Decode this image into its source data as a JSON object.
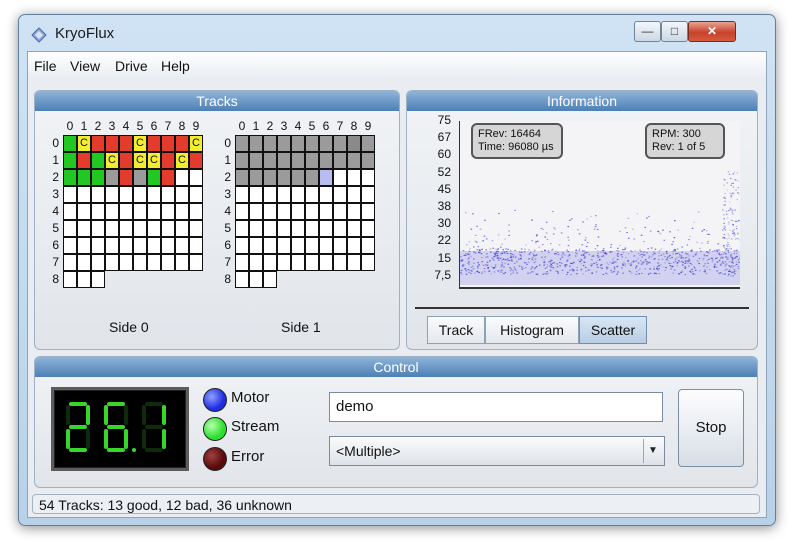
{
  "window": {
    "title": "KryoFlux"
  },
  "menu": {
    "items": [
      "File",
      "View",
      "Drive",
      "Help"
    ]
  },
  "tracks": {
    "header": "Tracks",
    "col_numbers": [
      "0",
      "1",
      "2",
      "3",
      "4",
      "5",
      "6",
      "7",
      "8",
      "9"
    ],
    "row_numbers": [
      "0",
      "1",
      "2",
      "3",
      "4",
      "5",
      "6",
      "7",
      "8"
    ],
    "side0_label": "Side 0",
    "side1_label": "Side 1",
    "cell_letter": "C",
    "side0_states": [
      [
        "good",
        "warn",
        "bad",
        "bad",
        "bad",
        "warn",
        "bad",
        "bad",
        "bad",
        "warn"
      ],
      [
        "good",
        "bad",
        "good",
        "warn",
        "bad",
        "warn",
        "warn",
        "bad",
        "warn",
        "bad"
      ],
      [
        "good",
        "good",
        "good",
        "grey",
        "bad",
        "grey",
        "good",
        "bad",
        "",
        ""
      ],
      [
        "",
        "",
        "",
        "",
        "",
        "",
        "",
        "",
        "",
        ""
      ],
      [
        "",
        "",
        "",
        "",
        "",
        "",
        "",
        "",
        "",
        ""
      ],
      [
        "",
        "",
        "",
        "",
        "",
        "",
        "",
        "",
        "",
        ""
      ],
      [
        "",
        "",
        "",
        "",
        "",
        "",
        "",
        "",
        "",
        ""
      ],
      [
        "",
        "",
        "",
        "",
        "",
        "",
        "",
        "",
        "",
        ""
      ],
      [
        "",
        "",
        "",
        "",
        "",
        "",
        "",
        "",
        "",
        ""
      ]
    ],
    "side1_states": [
      [
        "grey",
        "grey",
        "grey",
        "grey",
        "grey",
        "grey",
        "grey",
        "grey",
        "grey2",
        "grey"
      ],
      [
        "grey",
        "grey",
        "grey",
        "grey",
        "grey",
        "grey",
        "grey",
        "grey",
        "grey",
        "grey"
      ],
      [
        "grey",
        "grey",
        "grey",
        "grey",
        "grey",
        "grey",
        "blue",
        "",
        "",
        ""
      ],
      [
        "",
        "",
        "",
        "",
        "",
        "",
        "",
        "",
        "",
        ""
      ],
      [
        "",
        "",
        "",
        "",
        "",
        "",
        "",
        "",
        "",
        ""
      ],
      [
        "",
        "",
        "",
        "",
        "",
        "",
        "",
        "",
        "",
        ""
      ],
      [
        "",
        "",
        "",
        "",
        "",
        "",
        "",
        "",
        "",
        ""
      ],
      [
        "",
        "",
        "",
        "",
        "",
        "",
        "",
        "",
        "",
        ""
      ],
      [
        "",
        "",
        "",
        "",
        "",
        "",
        "",
        "",
        "",
        ""
      ]
    ],
    "side0_letters": [
      [
        "",
        "C",
        "",
        "",
        "",
        "C",
        "",
        "",
        "",
        "C"
      ],
      [
        "",
        "",
        "",
        "C",
        "",
        "C",
        "C",
        "",
        "C",
        ""
      ],
      [
        "",
        "",
        "",
        "",
        "",
        "",
        "",
        "",
        "",
        ""
      ]
    ]
  },
  "information": {
    "header": "Information",
    "y_ticks": [
      "75",
      "67",
      "60",
      "52",
      "45",
      "38",
      "30",
      "22",
      "15",
      "7,5"
    ],
    "frev_line": "FRev: 16464",
    "time_line": "Time: 96080 µs",
    "rpm_line": "RPM: 300",
    "rev_line": "Rev:   1 of 5",
    "tabs": [
      "Track",
      "Histogram",
      "Scatter"
    ],
    "active_tab": "Scatter",
    "scatter_color": "#3a3ad8"
  },
  "control": {
    "header": "Control",
    "display_digits": "26.1",
    "motor_label": "Motor",
    "stream_label": "Stream",
    "error_label": "Error",
    "motor_color": "#1f2ee0",
    "stream_color": "#2ce02c",
    "error_color": "#5a0a0a",
    "input_value": "demo",
    "combo_value": "<Multiple>",
    "stop_label": "Stop"
  },
  "status": {
    "text": "54 Tracks: 13 good, 12 bad, 36 unknown"
  }
}
